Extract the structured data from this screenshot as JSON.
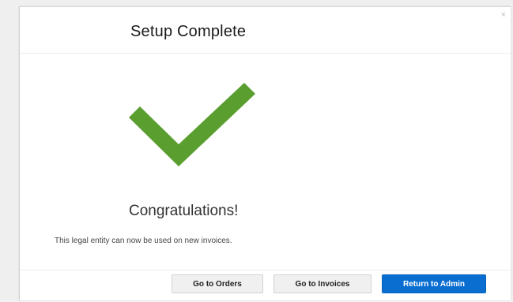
{
  "dialog": {
    "title": "Setup Complete",
    "close_glyph": "×"
  },
  "status": {
    "icon": "checkmark-icon",
    "check_color": "#5a9e2f",
    "heading": "Congratulations!",
    "description": "This legal entity can now be used on new invoices."
  },
  "footer": {
    "buttons": {
      "orders": "Go to Orders",
      "invoices": "Go to Invoices",
      "admin": "Return to Admin"
    },
    "primary_color": "#0a6ed1"
  }
}
